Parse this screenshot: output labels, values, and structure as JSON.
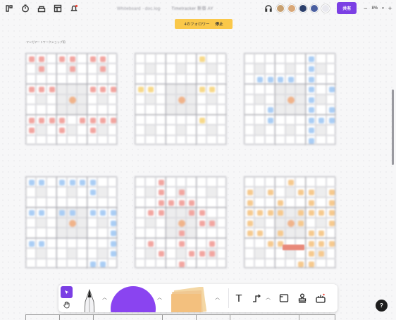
{
  "header": {
    "doc_title_blurred": "Whiteboard · doc.log",
    "doc_subtitle_blurred": "Timetracker 新宿 AY",
    "share_label": "共有",
    "zoom_level": "8%",
    "zoom_minus": "−",
    "zoom_plus": "+",
    "avatars": [
      "#c8a070",
      "#d9a777",
      "#2b3f6b",
      "#4a5fa0",
      "#e9e9ef"
    ]
  },
  "follow_banner": {
    "text": "4のフォロワー",
    "stop_label": "停止",
    "color": "#fac84a"
  },
  "canvas": {
    "caption": "マンガアートワークショップ用",
    "boards": [
      {
        "highlight_color": "#f2a5a0",
        "marks": [
          [
            0,
            0
          ],
          [
            0,
            1
          ],
          [
            0,
            3
          ],
          [
            0,
            4
          ],
          [
            0,
            6
          ],
          [
            0,
            7
          ],
          [
            1,
            1
          ],
          [
            1,
            4
          ],
          [
            1,
            7
          ],
          [
            3,
            0
          ],
          [
            3,
            1
          ],
          [
            3,
            2
          ],
          [
            3,
            6
          ],
          [
            3,
            7
          ],
          [
            3,
            8
          ],
          [
            6,
            0
          ],
          [
            6,
            1
          ],
          [
            6,
            2
          ],
          [
            6,
            3
          ],
          [
            6,
            5
          ],
          [
            6,
            6
          ],
          [
            6,
            7
          ],
          [
            6,
            8
          ],
          [
            7,
            0
          ],
          [
            7,
            3
          ],
          [
            7,
            6
          ]
        ]
      },
      {
        "highlight_color": "#f7d98a",
        "marks": [
          [
            0,
            6
          ],
          [
            3,
            0
          ],
          [
            3,
            1
          ],
          [
            3,
            6
          ],
          [
            3,
            7
          ],
          [
            6,
            6
          ]
        ]
      },
      {
        "highlight_color": "#a9cdf5",
        "marks": [
          [
            0,
            6
          ],
          [
            1,
            6
          ],
          [
            2,
            6
          ],
          [
            2,
            1
          ],
          [
            2,
            2
          ],
          [
            2,
            3
          ],
          [
            2,
            4
          ],
          [
            3,
            6
          ],
          [
            3,
            8
          ],
          [
            4,
            6
          ],
          [
            5,
            2
          ],
          [
            5,
            6
          ],
          [
            5,
            8
          ],
          [
            6,
            2
          ],
          [
            6,
            6
          ],
          [
            6,
            7
          ],
          [
            6,
            8
          ],
          [
            7,
            6
          ],
          [
            8,
            6
          ]
        ]
      },
      {
        "highlight_color": "#a9cdf5",
        "marks": [
          [
            0,
            0
          ],
          [
            0,
            1
          ],
          [
            0,
            3
          ],
          [
            0,
            4
          ],
          [
            0,
            5
          ],
          [
            0,
            6
          ],
          [
            1,
            6
          ],
          [
            3,
            0
          ],
          [
            3,
            1
          ],
          [
            3,
            3
          ],
          [
            3,
            4
          ],
          [
            3,
            6
          ],
          [
            3,
            7
          ],
          [
            3,
            8
          ],
          [
            4,
            8
          ],
          [
            5,
            8
          ],
          [
            6,
            0
          ],
          [
            6,
            1
          ],
          [
            6,
            8
          ],
          [
            7,
            8
          ],
          [
            8,
            6
          ],
          [
            8,
            7
          ]
        ]
      },
      {
        "highlight_color": "#f2a5a0",
        "marks": [
          [
            0,
            2
          ],
          [
            1,
            2
          ],
          [
            1,
            4
          ],
          [
            2,
            2
          ],
          [
            2,
            3
          ],
          [
            2,
            4
          ],
          [
            2,
            5
          ],
          [
            3,
            1
          ],
          [
            3,
            2
          ],
          [
            3,
            5
          ],
          [
            3,
            6
          ],
          [
            4,
            6
          ],
          [
            4,
            7
          ],
          [
            5,
            4
          ],
          [
            6,
            1
          ],
          [
            6,
            4
          ],
          [
            6,
            7
          ],
          [
            7,
            2
          ],
          [
            7,
            5
          ],
          [
            7,
            6
          ],
          [
            7,
            7
          ],
          [
            8,
            4
          ]
        ]
      },
      {
        "highlight_color": "#f6c98e",
        "marks": [
          [
            0,
            4
          ],
          [
            1,
            0
          ],
          [
            1,
            2
          ],
          [
            1,
            5
          ],
          [
            1,
            6
          ],
          [
            1,
            8
          ],
          [
            2,
            0
          ],
          [
            2,
            3
          ],
          [
            2,
            6
          ],
          [
            2,
            8
          ],
          [
            3,
            0
          ],
          [
            3,
            1
          ],
          [
            3,
            2
          ],
          [
            3,
            3
          ],
          [
            3,
            5
          ],
          [
            3,
            6
          ],
          [
            3,
            7
          ],
          [
            3,
            8
          ],
          [
            4,
            0
          ],
          [
            4,
            5
          ],
          [
            4,
            8
          ],
          [
            5,
            0
          ],
          [
            5,
            1
          ],
          [
            5,
            3
          ],
          [
            5,
            6
          ],
          [
            5,
            7
          ],
          [
            6,
            2
          ],
          [
            6,
            3
          ],
          [
            6,
            6
          ],
          [
            6,
            7
          ],
          [
            6,
            8
          ],
          [
            7,
            6
          ],
          [
            7,
            7
          ],
          [
            8,
            5
          ],
          [
            8,
            6
          ]
        ]
      }
    ]
  },
  "toolbar": {
    "tools": [
      "select-tool",
      "hand-tool",
      "pen-tool",
      "shape-tool",
      "sticky-tool",
      "text-tool",
      "connector-tool",
      "section-tool",
      "stamp-tool",
      "widgets-tool"
    ],
    "accent": "#7b3fe4",
    "text_tool_label": "T"
  },
  "help_label": "?"
}
